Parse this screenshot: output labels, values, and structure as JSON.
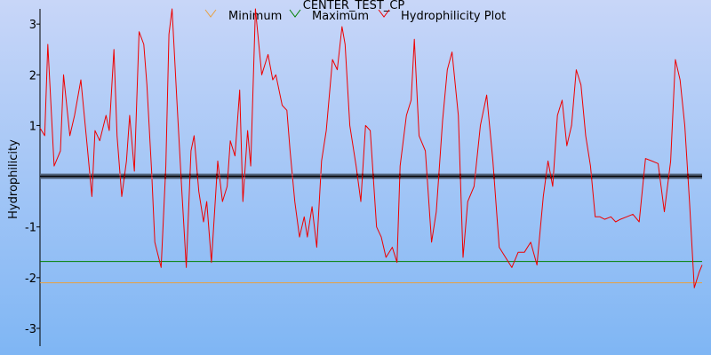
{
  "chart_data": {
    "type": "line",
    "title": "CENTER_TEST_CP",
    "xlabel": "",
    "ylabel": "Hydrophilicity",
    "ylim": [
      -3.35,
      3.3
    ],
    "yticks": [
      -3,
      -2,
      -1,
      1,
      2,
      3
    ],
    "xlim": [
      0,
      421
    ],
    "legend_position": "top",
    "series": [
      {
        "name": "Hydrophilicity Plot",
        "color": "#ee0000",
        "x": [
          0,
          3,
          5,
          9,
          13,
          15,
          19,
          22,
          26,
          30,
          33,
          35,
          38,
          42,
          44,
          47,
          49,
          52,
          55,
          57,
          60,
          63,
          66,
          68,
          71,
          73,
          77,
          80,
          82,
          84,
          87,
          90,
          93,
          96,
          98,
          101,
          104,
          106,
          109,
          113,
          116,
          119,
          121,
          124,
          127,
          129,
          132,
          134,
          137,
          141,
          145,
          148,
          150,
          154,
          157,
          159,
          162,
          165,
          168,
          170,
          173,
          176,
          179,
          182,
          186,
          189,
          192,
          194,
          197,
          201,
          204,
          207,
          210,
          214,
          217,
          220,
          224,
          227,
          229,
          233,
          236,
          238,
          241,
          245,
          249,
          252,
          256,
          259,
          262,
          266,
          269,
          272,
          276,
          280,
          284,
          288,
          292,
          296,
          300,
          304,
          308,
          312,
          316,
          320,
          323,
          326,
          329,
          332,
          335,
          338,
          341,
          344,
          347,
          350,
          353,
          356,
          359,
          363,
          366,
          369,
          373,
          377,
          381,
          385,
          389,
          393,
          397,
          401,
          404,
          407,
          410,
          413,
          416,
          419,
          421
        ],
        "values": [
          0.95,
          0.8,
          2.6,
          0.2,
          0.5,
          2.0,
          0.8,
          1.2,
          1.9,
          0.6,
          -0.4,
          0.9,
          0.7,
          1.2,
          0.9,
          2.5,
          0.8,
          -0.4,
          0.3,
          1.2,
          0.1,
          2.85,
          2.6,
          1.8,
          0.1,
          -1.3,
          -1.8,
          0.2,
          2.8,
          3.3,
          1.5,
          -0.2,
          -1.8,
          0.5,
          0.8,
          -0.3,
          -0.9,
          -0.5,
          -1.7,
          0.3,
          -0.5,
          -0.2,
          0.7,
          0.4,
          1.7,
          -0.5,
          0.9,
          0.2,
          3.3,
          2.0,
          2.4,
          1.9,
          2.0,
          1.4,
          1.3,
          0.5,
          -0.5,
          -1.2,
          -0.8,
          -1.2,
          -0.6,
          -1.4,
          0.3,
          0.9,
          2.3,
          2.1,
          2.95,
          2.6,
          1.0,
          0.2,
          -0.5,
          1.0,
          0.9,
          -1.0,
          -1.2,
          -1.6,
          -1.4,
          -1.7,
          0.2,
          1.2,
          1.5,
          2.7,
          0.8,
          0.5,
          -1.3,
          -0.7,
          1.1,
          2.1,
          2.45,
          1.2,
          -1.6,
          -0.5,
          -0.2,
          1.0,
          1.6,
          0.3,
          -1.4,
          -1.6,
          -1.8,
          -1.5,
          -1.5,
          -1.3,
          -1.75,
          -0.4,
          0.3,
          -0.2,
          1.2,
          1.5,
          0.6,
          1.0,
          2.1,
          1.8,
          0.8,
          0.2,
          -0.8,
          -0.8,
          -0.85,
          -0.8,
          -0.9,
          -0.85,
          -0.8,
          -0.75,
          -0.9,
          0.35,
          0.3,
          0.25,
          -0.7,
          0.3,
          2.3,
          1.9,
          1.0,
          -0.5,
          -2.2,
          -1.9,
          -1.75
        ]
      },
      {
        "name": "Maximum",
        "color": "#008000",
        "values": [
          -1.68,
          -1.68
        ]
      },
      {
        "name": "Minimum",
        "color": "#e8a040",
        "values": [
          -2.1,
          -2.1
        ]
      }
    ],
    "baseline": {
      "value": 0,
      "color": "#000000",
      "marker": "tick"
    },
    "grid": false,
    "background": {
      "top": "#c8d6f8",
      "bottom": "#7fb6f4"
    }
  },
  "legend": {
    "minimum_label": "Minimum",
    "maximum_label": "Maximum",
    "plot_label": "Hydrophilicity Plot"
  },
  "colors": {
    "axis": "#000000",
    "legend_icon_minimum": "#e8a040",
    "legend_icon_maximum": "#008000",
    "legend_icon_plot": "#ee0000"
  }
}
